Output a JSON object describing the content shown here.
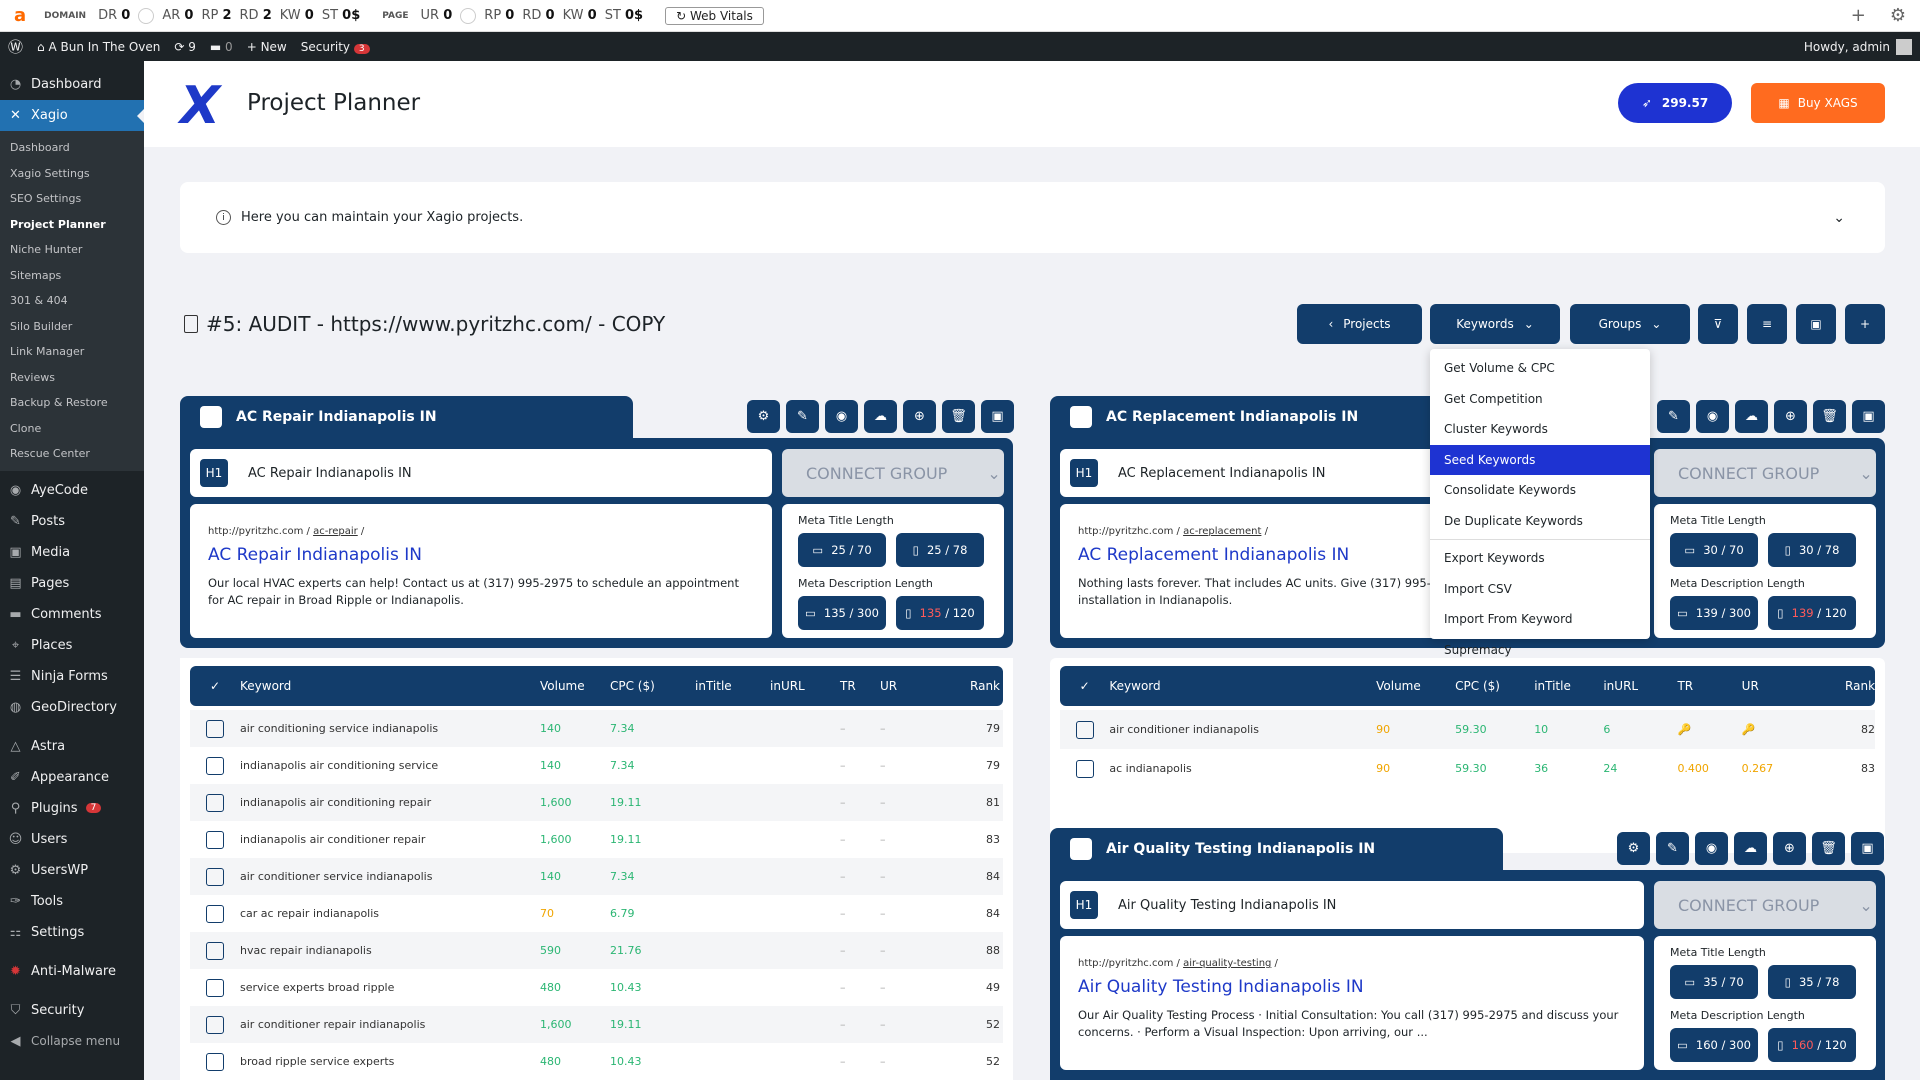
{
  "seobar": {
    "domain_label": "DOMAIN",
    "dr": "0",
    "ar": "0",
    "rp": "2",
    "rd": "2",
    "kw": "0",
    "st": "0$",
    "page_label": "PAGE",
    "ur": "0",
    "prp": "0",
    "prd": "0",
    "pkw": "0",
    "pst": "0$",
    "web_vitals": "Web Vitals"
  },
  "adminbar": {
    "site": "A Bun In The Oven",
    "updates": "9",
    "comments": "0",
    "new": "New",
    "security": "Security",
    "security_count": "3",
    "howdy": "Howdy, admin"
  },
  "sidebar": {
    "dashboard": "Dashboard",
    "xagio": "Xagio",
    "sub": [
      "Dashboard",
      "Xagio Settings",
      "SEO Settings",
      "Project Planner",
      "Niche Hunter",
      "Sitemaps",
      "301 & 404",
      "Silo Builder",
      "Link Manager",
      "Reviews",
      "Backup & Restore",
      "Clone",
      "Rescue Center"
    ],
    "items": [
      {
        "label": "AyeCode",
        "icon": "◉"
      },
      {
        "label": "Posts",
        "icon": "✎"
      },
      {
        "label": "Media",
        "icon": "▣"
      },
      {
        "label": "Pages",
        "icon": "▤"
      },
      {
        "label": "Comments",
        "icon": "▬"
      },
      {
        "label": "Places",
        "icon": "⌖"
      },
      {
        "label": "Ninja Forms",
        "icon": "☰"
      },
      {
        "label": "GeoDirectory",
        "icon": "◍"
      }
    ],
    "items2": [
      {
        "label": "Astra",
        "icon": "△"
      },
      {
        "label": "Appearance",
        "icon": "✐"
      },
      {
        "label": "Plugins",
        "icon": "⚲",
        "badge": "7"
      },
      {
        "label": "Users",
        "icon": "☺"
      },
      {
        "label": "UsersWP",
        "icon": "⚙"
      },
      {
        "label": "Tools",
        "icon": "✑"
      },
      {
        "label": "Settings",
        "icon": "⚏"
      }
    ],
    "antimalware": "Anti-Malware",
    "security": "Security",
    "collapse": "Collapse menu"
  },
  "header": {
    "title": "Project Planner",
    "credits": "299.57",
    "buy": "Buy XAGS"
  },
  "info": {
    "text": "Here you can maintain your Xagio projects."
  },
  "project": {
    "title": "#5: AUDIT - https://www.pyritzhc.com/ - COPY"
  },
  "toolbar": {
    "projects": "Projects",
    "keywords": "Keywords",
    "groups": "Groups"
  },
  "menu": {
    "items": [
      "Get Volume & CPC",
      "Get Competition",
      "Cluster Keywords",
      "Seed Keywords",
      "Consolidate Keywords",
      "De Duplicate Keywords"
    ],
    "items2": [
      "Export Keywords",
      "Import CSV",
      "Import From Keyword Supremacy"
    ]
  },
  "groups": [
    {
      "name": "AC Repair Indianapolis IN",
      "h1": "AC Repair Indianapolis IN",
      "connect": "CONNECT GROUP",
      "url_base": "http://pyritzhc.com",
      "url_slug": "ac-repair",
      "serp_title": "AC Repair Indianapolis IN",
      "serp_desc": "Our local HVAC experts can help! Contact us at (317) 995-2975 to schedule an appointment for AC repair in Broad Ripple or Indianapolis.",
      "meta_title_label": "Meta Title Length",
      "mt_desktop": "25 / 70",
      "mt_mobile": "25 / 78",
      "meta_desc_label": "Meta Description Length",
      "md_desktop": "135 / 300",
      "md_mobile": "135",
      "md_mobile_max": " / 120"
    },
    {
      "name": "AC Replacement Indianapolis IN",
      "h1": "AC Replacement Indianapolis IN",
      "connect": "CONNECT GROUP",
      "url_base": "http://pyritzhc.com",
      "url_slug": "ac-replacement",
      "serp_title": "AC Replacement Indianapolis IN",
      "serp_desc": "Nothing lasts forever. That includes AC units. Give (317) 995-2975 appointment for AC installation in Indianapolis.",
      "meta_title_label": "Meta Title Length",
      "mt_desktop": "30 / 70",
      "mt_mobile": "30 / 78",
      "meta_desc_label": "Meta Description Length",
      "md_desktop": "139 / 300",
      "md_mobile": "139",
      "md_mobile_max": " / 120"
    },
    {
      "name": "Air Quality Testing Indianapolis IN",
      "h1": "Air Quality Testing Indianapolis IN",
      "connect": "CONNECT GROUP",
      "url_base": "http://pyritzhc.com",
      "url_slug": "air-quality-testing",
      "serp_title": "Air Quality Testing Indianapolis IN",
      "serp_desc": "Our Air Quality Testing Process · Initial Consultation: You call (317) 995-2975 and discuss your concerns. · Perform a Visual Inspection: Upon arriving, our ...",
      "meta_title_label": "Meta Title Length",
      "mt_desktop": "35 / 70",
      "mt_mobile": "35 / 78",
      "meta_desc_label": "Meta Description Length",
      "md_desktop": "160 / 300",
      "md_mobile": "160",
      "md_mobile_max": " / 120"
    }
  ],
  "table_headers": [
    "Keyword",
    "Volume",
    "CPC ($)",
    "inTitle",
    "inURL",
    "TR",
    "UR",
    "Rank"
  ],
  "table1": [
    [
      "air conditioning service indianapolis",
      "140",
      "7.34",
      "",
      "",
      "–",
      "–",
      "79"
    ],
    [
      "indianapolis air conditioning service",
      "140",
      "7.34",
      "",
      "",
      "–",
      "–",
      "79"
    ],
    [
      "indianapolis air conditioning repair",
      "1,600",
      "19.11",
      "",
      "",
      "–",
      "–",
      "81"
    ],
    [
      "indianapolis air conditioner repair",
      "1,600",
      "19.11",
      "",
      "",
      "–",
      "–",
      "83"
    ],
    [
      "air conditioner service indianapolis",
      "140",
      "7.34",
      "",
      "",
      "–",
      "–",
      "84"
    ],
    [
      "car ac repair indianapolis",
      "70",
      "6.79",
      "",
      "",
      "–",
      "–",
      "84"
    ],
    [
      "hvac repair indianapolis",
      "590",
      "21.76",
      "",
      "",
      "–",
      "–",
      "88"
    ],
    [
      "service experts broad ripple",
      "480",
      "10.43",
      "",
      "",
      "–",
      "–",
      "49"
    ],
    [
      "air conditioner repair indianapolis",
      "1,600",
      "19.11",
      "",
      "",
      "–",
      "–",
      "52"
    ],
    [
      "broad ripple service experts",
      "480",
      "10.43",
      "",
      "",
      "–",
      "–",
      "52"
    ]
  ],
  "table2": [
    [
      "air conditioner indianapolis",
      "90",
      "59.30",
      "10",
      "6",
      "🔑",
      "🔑",
      "82"
    ],
    [
      "ac indianapolis",
      "90",
      "59.30",
      "36",
      "24",
      "0.400",
      "0.267",
      "83"
    ]
  ]
}
